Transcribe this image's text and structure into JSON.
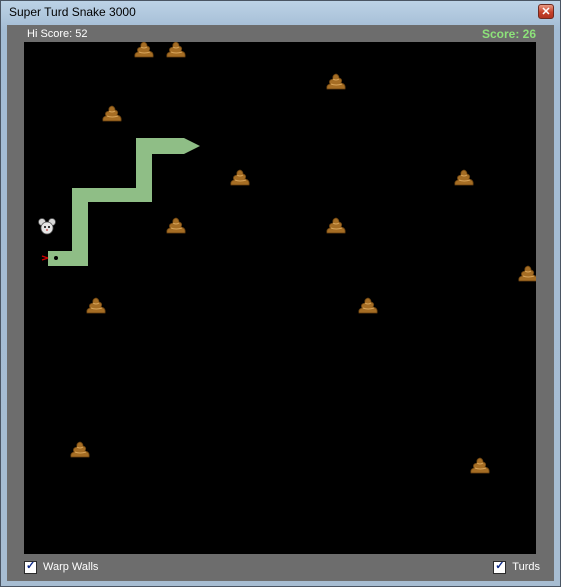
{
  "window": {
    "title": "Super Turd Snake 3000"
  },
  "header": {
    "hi_score": "Hi Score: 52",
    "score": "Score: 26"
  },
  "options": {
    "warp_walls_label": "Warp Walls",
    "warp_walls_checked": true,
    "turds_label": "Turds",
    "turds_checked": true
  },
  "colors": {
    "snake": "#8fbe86",
    "turd": "#b07a2a",
    "board": "#000000",
    "score": "#8de27a"
  }
}
